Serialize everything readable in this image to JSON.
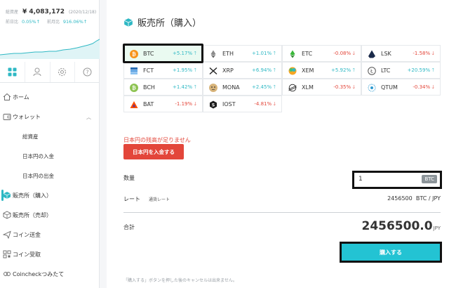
{
  "balance": {
    "total_label": "総資産",
    "total_value": "¥ 4,083,172",
    "date": "(2020/12/18)",
    "day_label": "前日比",
    "day_pct": "0.05%↑",
    "month_label": "前月比",
    "month_pct": "916.06%↑"
  },
  "colors": {
    "accent": "#2eb8c4",
    "danger": "#e3463a",
    "buy": "#23c3d3"
  },
  "sidebar_tabs": [
    {
      "icon": "grid-icon",
      "active": true
    },
    {
      "icon": "user-icon",
      "active": false
    },
    {
      "icon": "gear-icon",
      "active": false
    },
    {
      "icon": "help-icon",
      "active": false
    }
  ],
  "menu": [
    {
      "label": "ホーム",
      "icon": "home-icon"
    },
    {
      "label": "ウォレット",
      "icon": "wallet-icon"
    },
    {
      "label": "総資産"
    },
    {
      "label": "日本円の入金"
    },
    {
      "label": "日本円の出金"
    },
    {
      "label": "販売所（購入）",
      "icon": "buy-icon",
      "active": true
    },
    {
      "label": "販売所（売却）",
      "icon": "sell-icon"
    },
    {
      "label": "コイン送金",
      "icon": "send-icon"
    },
    {
      "label": "コイン受取",
      "icon": "qr-icon"
    },
    {
      "label": "Coincheckつみたて",
      "icon": "recurring-icon"
    }
  ],
  "page": {
    "title": "販売所（購入）"
  },
  "coins": [
    {
      "symbol": "BTC",
      "change": "+5.17%",
      "dir": "up",
      "icon": "btc-icon",
      "selected": true
    },
    {
      "symbol": "ETH",
      "change": "+1.01%",
      "dir": "up",
      "icon": "eth-icon"
    },
    {
      "symbol": "ETC",
      "change": "-0.08%",
      "dir": "down",
      "icon": "etc-icon"
    },
    {
      "symbol": "LSK",
      "change": "-1.58%",
      "dir": "down",
      "icon": "lsk-icon"
    },
    {
      "symbol": "FCT",
      "change": "+1.95%",
      "dir": "up",
      "icon": "fct-icon"
    },
    {
      "symbol": "XRP",
      "change": "+6.94%",
      "dir": "up",
      "icon": "xrp-icon"
    },
    {
      "symbol": "XEM",
      "change": "+5.92%",
      "dir": "up",
      "icon": "xem-icon"
    },
    {
      "symbol": "LTC",
      "change": "+20.59%",
      "dir": "up",
      "icon": "ltc-icon"
    },
    {
      "symbol": "BCH",
      "change": "+1.42%",
      "dir": "up",
      "icon": "bch-icon"
    },
    {
      "symbol": "MONA",
      "change": "+2.45%",
      "dir": "up",
      "icon": "mona-icon"
    },
    {
      "symbol": "XLM",
      "change": "-0.35%",
      "dir": "down",
      "icon": "xlm-icon"
    },
    {
      "symbol": "QTUM",
      "change": "-0.34%",
      "dir": "down",
      "icon": "qtum-icon"
    },
    {
      "symbol": "BAT",
      "change": "-1.19%",
      "dir": "down",
      "icon": "bat-icon"
    },
    {
      "symbol": "IOST",
      "change": "-4.81%",
      "dir": "down",
      "icon": "iost-icon"
    }
  ],
  "warning": "日本円の残高が足りません",
  "deposit_button": "日本円を入金する",
  "order": {
    "qty_label": "数量",
    "qty_value": "1",
    "qty_unit": "BTC",
    "rate_label": "レート",
    "rate_sub": "通貨レート",
    "rate_value": "2456500",
    "rate_unit": "BTC / JPY",
    "total_label": "合計",
    "total_value": "2456500.0",
    "total_unit": "JPY",
    "buy_label": "購入する",
    "note": "「購入する」ボタンを押した後のキャンセルは出来ません。"
  }
}
